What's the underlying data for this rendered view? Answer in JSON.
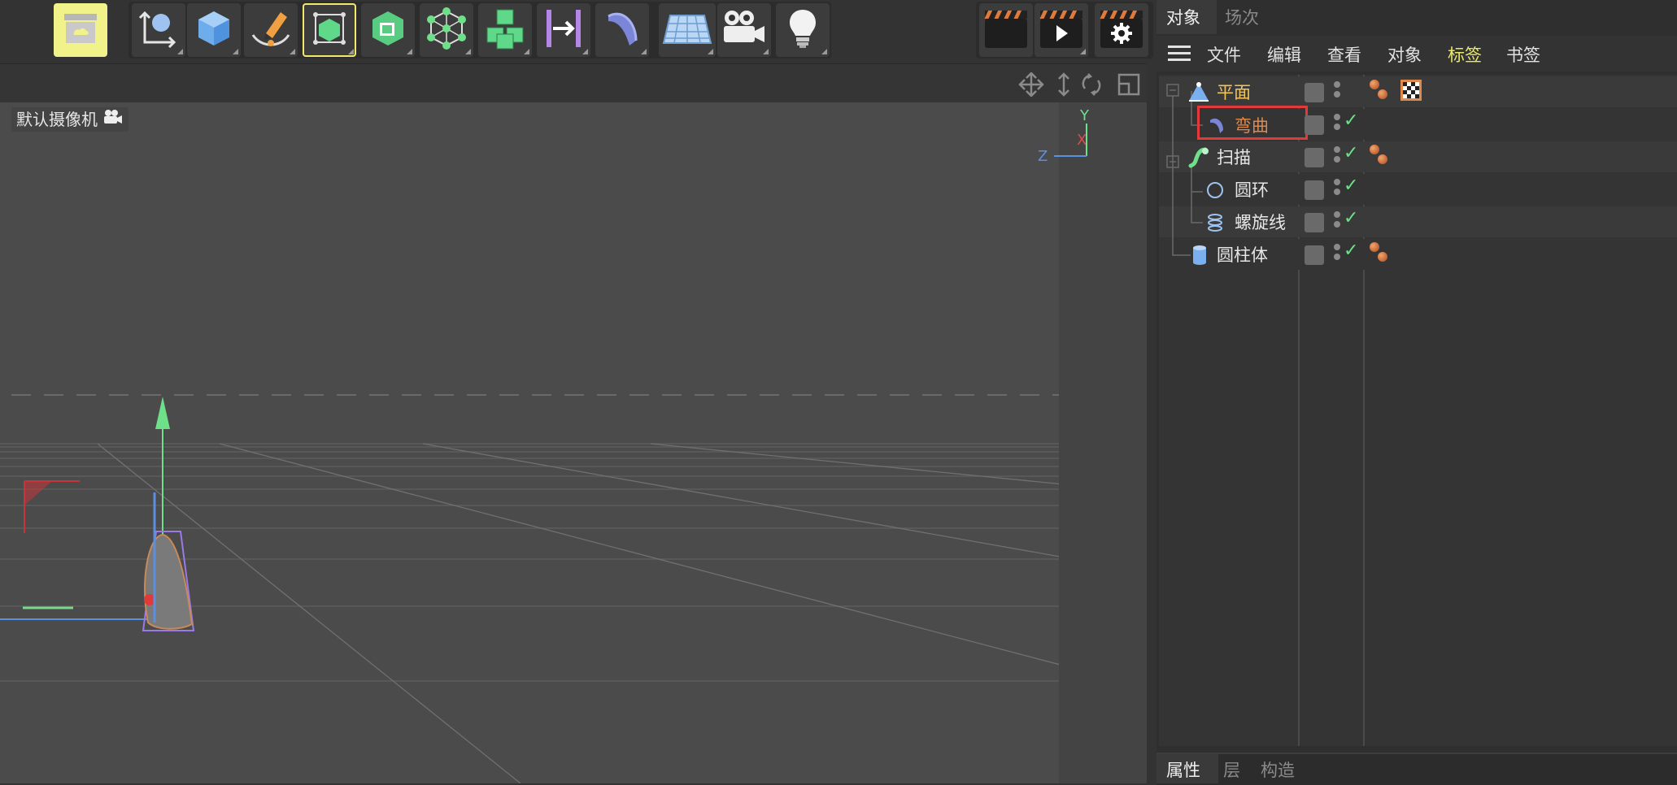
{
  "toolbar": {
    "buttons": [
      {
        "name": "undo-archive-icon"
      },
      {
        "name": "coordinate-system-icon"
      },
      {
        "name": "cube-icon"
      },
      {
        "name": "pen-spline-icon"
      },
      {
        "name": "subdivision-surface-icon"
      },
      {
        "name": "extrude-icon"
      },
      {
        "name": "polygon-structure-icon"
      },
      {
        "name": "cloner-icon"
      },
      {
        "name": "symmetry-icon"
      },
      {
        "name": "bend-deformer-icon"
      },
      {
        "name": "floor-grid-icon"
      },
      {
        "name": "camera-icon"
      },
      {
        "name": "light-icon"
      },
      {
        "name": "render-region-icon"
      },
      {
        "name": "render-play-icon"
      },
      {
        "name": "render-settings-icon"
      }
    ]
  },
  "viewport": {
    "camera_label": "默认摄像机",
    "axis_labels": {
      "y": "Y",
      "x": "X",
      "z": "Z"
    },
    "nav_icons": [
      "move-view-icon",
      "pan-view-icon",
      "rotate-view-icon",
      "maximize-view-icon"
    ]
  },
  "object_manager": {
    "tabs": [
      {
        "label": "对象",
        "active": true
      },
      {
        "label": "场次",
        "active": false
      }
    ],
    "menu": [
      {
        "label": "文件",
        "highlight": false
      },
      {
        "label": "编辑",
        "highlight": false
      },
      {
        "label": "查看",
        "highlight": false
      },
      {
        "label": "对象",
        "highlight": false
      },
      {
        "label": "标签",
        "highlight": true
      },
      {
        "label": "书签",
        "highlight": false
      }
    ],
    "objects": [
      {
        "label": "平面",
        "icon": "plane-icon",
        "color": "#f2c55c",
        "check": false,
        "tags": [
          "material-tag",
          "checker-tag"
        ]
      },
      {
        "label": "弯曲",
        "icon": "bend-deformer-icon",
        "color": "#e0894d",
        "check": true,
        "tags": [],
        "selected_box": true
      },
      {
        "label": "扫描",
        "icon": "sweep-icon",
        "color": "#e6e6e6",
        "check": true,
        "tags": [
          "material-tag"
        ]
      },
      {
        "label": "圆环",
        "icon": "circle-spline-icon",
        "color": "#e6e6e6",
        "check": true,
        "tags": []
      },
      {
        "label": "螺旋线",
        "icon": "helix-spline-icon",
        "color": "#e6e6e6",
        "check": true,
        "tags": []
      },
      {
        "label": "圆柱体",
        "icon": "cylinder-icon",
        "color": "#e6e6e6",
        "check": true,
        "tags": [
          "material-tag"
        ]
      }
    ]
  },
  "attribute_tabs": [
    {
      "label": "属性",
      "active": true
    },
    {
      "label": "层",
      "active": false
    },
    {
      "label": "构造",
      "active": false
    }
  ],
  "colors": {
    "accent_yellow": "#f2e86b",
    "highlight_red": "#e23a3a",
    "check_green": "#6fe08a"
  }
}
